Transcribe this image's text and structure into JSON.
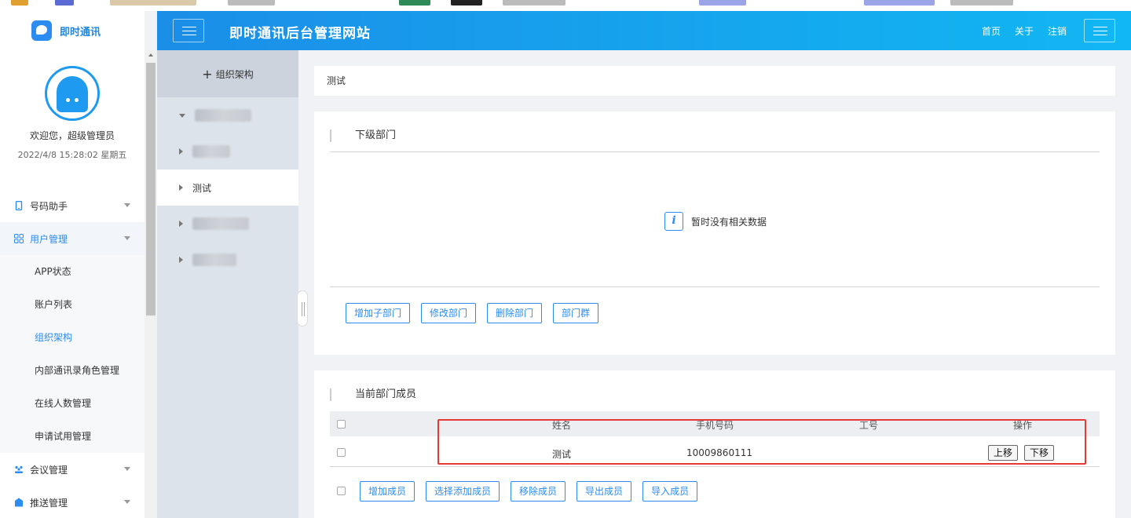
{
  "sidebar": {
    "logo_text": "即时通讯",
    "welcome": "欢迎您，超级管理员",
    "datetime": "2022/4/8 15:28:02 星期五",
    "menu": [
      {
        "label": "号码助手",
        "icon": "phone-icon"
      },
      {
        "label": "用户管理",
        "icon": "grid-icon"
      },
      {
        "label": "会议管理",
        "icon": "meeting-icon"
      },
      {
        "label": "推送管理",
        "icon": "push-icon"
      }
    ],
    "submenu": [
      "APP状态",
      "账户列表",
      "组织架构",
      "内部通讯录角色管理",
      "在线人数管理",
      "申请试用管理"
    ]
  },
  "header": {
    "title": "即时通讯后台管理网站",
    "links": [
      "首页",
      "关于",
      "注销"
    ]
  },
  "tree": {
    "add_label": "组织架构",
    "selected_node": "测试"
  },
  "breadcrumb": "测试",
  "sub_dept": {
    "title": "下级部门",
    "empty_text": "暂时没有相关数据",
    "buttons": [
      "增加子部门",
      "修改部门",
      "删除部门",
      "部门群"
    ]
  },
  "members": {
    "title": "当前部门成员",
    "columns": [
      "姓名",
      "手机号码",
      "工号",
      "操作"
    ],
    "rows": [
      {
        "name": "测试",
        "phone": "10009860111",
        "emp_no": "",
        "actions": [
          "上移",
          "下移"
        ]
      }
    ],
    "buttons": [
      "增加成员",
      "选择添加成员",
      "移除成员",
      "导出成员",
      "导入成员"
    ]
  },
  "colors": {
    "accent": "#2d8cf0",
    "header_start": "#1b8ee8",
    "header_end": "#11b7f2",
    "highlight": "#e53935"
  }
}
